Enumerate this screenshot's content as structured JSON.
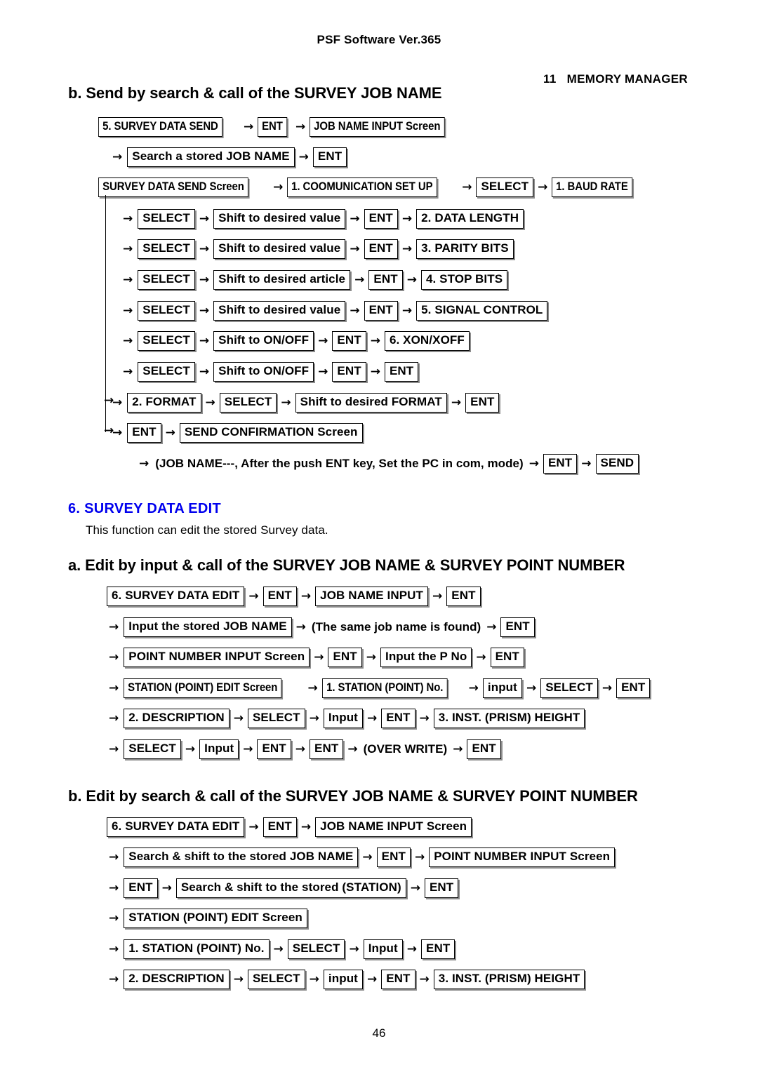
{
  "header": {
    "doc_title": "PSF Software Ver.365",
    "chapter": "11   MEMORY MANAGER"
  },
  "footer": {
    "page_number": "46"
  },
  "colors": {
    "section_heading": "#0000EE",
    "text": "#000000",
    "background": "#FFFFFF"
  },
  "arrow_glyph": "→",
  "sections": [
    {
      "id": "send-by-search",
      "heading": "b. Send by search & call of the SURVEY JOB NAME",
      "rows": [
        {
          "lead_arrow": false,
          "items": [
            {
              "type": "box",
              "label": "5. SURVEY DATA SEND",
              "style": "narrow"
            },
            {
              "type": "box",
              "label": "ENT",
              "style": "narrow"
            },
            {
              "type": "box",
              "label": "JOB NAME INPUT Screen",
              "style": "narrow"
            }
          ]
        },
        {
          "lead_arrow": true,
          "items": [
            {
              "type": "box",
              "label": "Search a stored JOB NAME",
              "style": "normal"
            },
            {
              "type": "box",
              "label": "ENT",
              "style": "normal"
            }
          ]
        },
        {
          "lead_arrow": false,
          "items": [
            {
              "type": "box",
              "label": "SURVEY DATA SEND Screen",
              "style": "narrow"
            },
            {
              "type": "box",
              "label": "1. COOMUNICATION SET UP",
              "style": "narrow"
            },
            {
              "type": "box",
              "label": "SELECT",
              "style": "normal"
            },
            {
              "type": "box",
              "label": "1. BAUD  RATE",
              "style": "narrow"
            }
          ]
        },
        {
          "lead_arrow": true,
          "items": [
            {
              "type": "box",
              "label": "SELECT",
              "style": "normal"
            },
            {
              "type": "box",
              "label": "Shift to desired value",
              "style": "normal"
            },
            {
              "type": "box",
              "label": "ENT",
              "style": "normal"
            },
            {
              "type": "box",
              "label": "2. DATA LENGTH",
              "style": "normal"
            }
          ]
        },
        {
          "lead_arrow": true,
          "items": [
            {
              "type": "box",
              "label": "SELECT",
              "style": "normal"
            },
            {
              "type": "box",
              "label": "Shift to desired value",
              "style": "normal"
            },
            {
              "type": "box",
              "label": "ENT",
              "style": "normal"
            },
            {
              "type": "box",
              "label": "3. PARITY BITS",
              "style": "normal"
            }
          ]
        },
        {
          "lead_arrow": true,
          "items": [
            {
              "type": "box",
              "label": "SELECT",
              "style": "normal"
            },
            {
              "type": "box",
              "label": "Shift to desired article",
              "style": "normal"
            },
            {
              "type": "box",
              "label": "ENT",
              "style": "normal"
            },
            {
              "type": "box",
              "label": "4. STOP BITS",
              "style": "normal"
            }
          ]
        },
        {
          "lead_arrow": true,
          "items": [
            {
              "type": "box",
              "label": "SELECT",
              "style": "normal"
            },
            {
              "type": "box",
              "label": "Shift to desired value",
              "style": "normal"
            },
            {
              "type": "box",
              "label": "ENT",
              "style": "normal"
            },
            {
              "type": "box",
              "label": "5. SIGNAL CONTROL",
              "style": "normal"
            }
          ]
        },
        {
          "lead_arrow": true,
          "items": [
            {
              "type": "box",
              "label": "SELECT",
              "style": "normal"
            },
            {
              "type": "box",
              "label": "Shift to ON/OFF",
              "style": "normal"
            },
            {
              "type": "box",
              "label": "ENT",
              "style": "normal"
            },
            {
              "type": "box",
              "label": "6. XON/XOFF",
              "style": "normal"
            }
          ]
        },
        {
          "lead_arrow": true,
          "items": [
            {
              "type": "box",
              "label": "SELECT",
              "style": "normal"
            },
            {
              "type": "box",
              "label": "Shift to ON/OFF",
              "style": "normal"
            },
            {
              "type": "box",
              "label": "ENT",
              "style": "normal"
            },
            {
              "type": "box",
              "label": "ENT",
              "style": "normal"
            }
          ]
        },
        {
          "lead_arrow": true,
          "items": [
            {
              "type": "box",
              "label": "2. FORMAT",
              "style": "normal"
            },
            {
              "type": "box",
              "label": "SELECT",
              "style": "normal"
            },
            {
              "type": "box",
              "label": "Shift to desired FORMAT",
              "style": "normal"
            },
            {
              "type": "box",
              "label": "ENT",
              "style": "normal"
            }
          ]
        },
        {
          "lead_arrow": true,
          "items": [
            {
              "type": "box",
              "label": "ENT",
              "style": "normal"
            },
            {
              "type": "box",
              "label": "SEND CONFIRMATION Screen",
              "style": "normal"
            }
          ]
        },
        {
          "lead_arrow": true,
          "items": [
            {
              "type": "plain",
              "label": "(JOB NAME---, After the push ENT key, Set the PC in com, mode)"
            },
            {
              "type": "box",
              "label": "ENT",
              "style": "normal"
            },
            {
              "type": "box",
              "label": "SEND",
              "style": "normal"
            }
          ]
        }
      ]
    },
    {
      "id": "survey-data-edit",
      "heading": "6. SURVEY DATA EDIT",
      "description": "This function can edit the stored Survey data."
    },
    {
      "id": "edit-by-input",
      "heading": "a. Edit by input & call of the SURVEY JOB NAME & SURVEY POINT NUMBER",
      "rows": [
        {
          "lead_arrow": false,
          "items": [
            {
              "type": "box",
              "label": "6. SURVEY DATA EDIT",
              "style": "normal"
            },
            {
              "type": "box",
              "label": "ENT",
              "style": "normal"
            },
            {
              "type": "box",
              "label": "JOB NAME INPUT",
              "style": "normal"
            },
            {
              "type": "box",
              "label": "ENT",
              "style": "normal"
            }
          ]
        },
        {
          "lead_arrow": true,
          "items": [
            {
              "type": "box",
              "label": "Input the stored JOB NAME",
              "style": "normal"
            },
            {
              "type": "plain",
              "label": "(The same job name is found)"
            },
            {
              "type": "box",
              "label": "ENT",
              "style": "normal"
            }
          ]
        },
        {
          "lead_arrow": true,
          "items": [
            {
              "type": "box",
              "label": "POINT NUMBER INPUT Screen",
              "style": "normal"
            },
            {
              "type": "box",
              "label": "ENT",
              "style": "normal"
            },
            {
              "type": "box",
              "label": "Input the P No",
              "style": "normal"
            },
            {
              "type": "box",
              "label": "ENT",
              "style": "normal"
            }
          ]
        },
        {
          "lead_arrow": true,
          "items": [
            {
              "type": "box",
              "label": "STATION (POINT) EDIT Screen",
              "style": "narrow"
            },
            {
              "type": "box",
              "label": "1. STATION (POINT) No.",
              "style": "narrow"
            },
            {
              "type": "box",
              "label": "input",
              "style": "normal"
            },
            {
              "type": "box",
              "label": "SELECT",
              "style": "normal"
            },
            {
              "type": "box",
              "label": "ENT",
              "style": "normal"
            }
          ]
        },
        {
          "lead_arrow": true,
          "items": [
            {
              "type": "box",
              "label": "2. DESCRIPTION",
              "style": "normal"
            },
            {
              "type": "box",
              "label": "SELECT",
              "style": "normal"
            },
            {
              "type": "box",
              "label": "Input",
              "style": "normal"
            },
            {
              "type": "box",
              "label": "ENT",
              "style": "normal"
            },
            {
              "type": "box",
              "label": "3. INST. (PRISM) HEIGHT",
              "style": "normal"
            }
          ]
        },
        {
          "lead_arrow": true,
          "items": [
            {
              "type": "box",
              "label": "SELECT",
              "style": "normal"
            },
            {
              "type": "box",
              "label": "Input",
              "style": "normal"
            },
            {
              "type": "box",
              "label": "ENT",
              "style": "normal"
            },
            {
              "type": "box",
              "label": "ENT",
              "style": "normal"
            },
            {
              "type": "plain",
              "label": "(OVER WRITE)"
            },
            {
              "type": "box",
              "label": "ENT",
              "style": "normal"
            }
          ]
        }
      ]
    },
    {
      "id": "edit-by-search",
      "heading": "b. Edit by search & call of the SURVEY JOB NAME & SURVEY POINT NUMBER",
      "rows": [
        {
          "lead_arrow": false,
          "items": [
            {
              "type": "box",
              "label": "6. SURVEY DATA EDIT",
              "style": "normal"
            },
            {
              "type": "box",
              "label": "ENT",
              "style": "normal"
            },
            {
              "type": "box",
              "label": "JOB NAME INPUT Screen",
              "style": "normal"
            }
          ]
        },
        {
          "lead_arrow": true,
          "items": [
            {
              "type": "box",
              "label": "Search & shift to the stored JOB NAME",
              "style": "normal"
            },
            {
              "type": "box",
              "label": "ENT",
              "style": "normal"
            },
            {
              "type": "box",
              "label": "POINT NUMBER INPUT Screen",
              "style": "normal"
            }
          ]
        },
        {
          "lead_arrow": true,
          "items": [
            {
              "type": "box",
              "label": "ENT",
              "style": "normal"
            },
            {
              "type": "box",
              "label": "Search & shift to the stored (STATION)",
              "style": "normal"
            },
            {
              "type": "box",
              "label": "ENT",
              "style": "normal"
            }
          ]
        },
        {
          "lead_arrow": true,
          "items": [
            {
              "type": "box",
              "label": "STATION (POINT) EDIT Screen",
              "style": "normal"
            }
          ]
        },
        {
          "lead_arrow": true,
          "items": [
            {
              "type": "box",
              "label": "1. STATION (POINT) No.",
              "style": "normal"
            },
            {
              "type": "box",
              "label": "SELECT",
              "style": "normal"
            },
            {
              "type": "box",
              "label": "Input",
              "style": "normal"
            },
            {
              "type": "box",
              "label": "ENT",
              "style": "normal"
            }
          ]
        },
        {
          "lead_arrow": true,
          "items": [
            {
              "type": "box",
              "label": "2. DESCRIPTION",
              "style": "normal"
            },
            {
              "type": "box",
              "label": "SELECT",
              "style": "normal"
            },
            {
              "type": "box",
              "label": "input",
              "style": "normal"
            },
            {
              "type": "box",
              "label": "ENT",
              "style": "normal"
            },
            {
              "type": "box",
              "label": "3. INST. (PRISM) HEIGHT",
              "style": "normal"
            }
          ]
        }
      ]
    }
  ]
}
